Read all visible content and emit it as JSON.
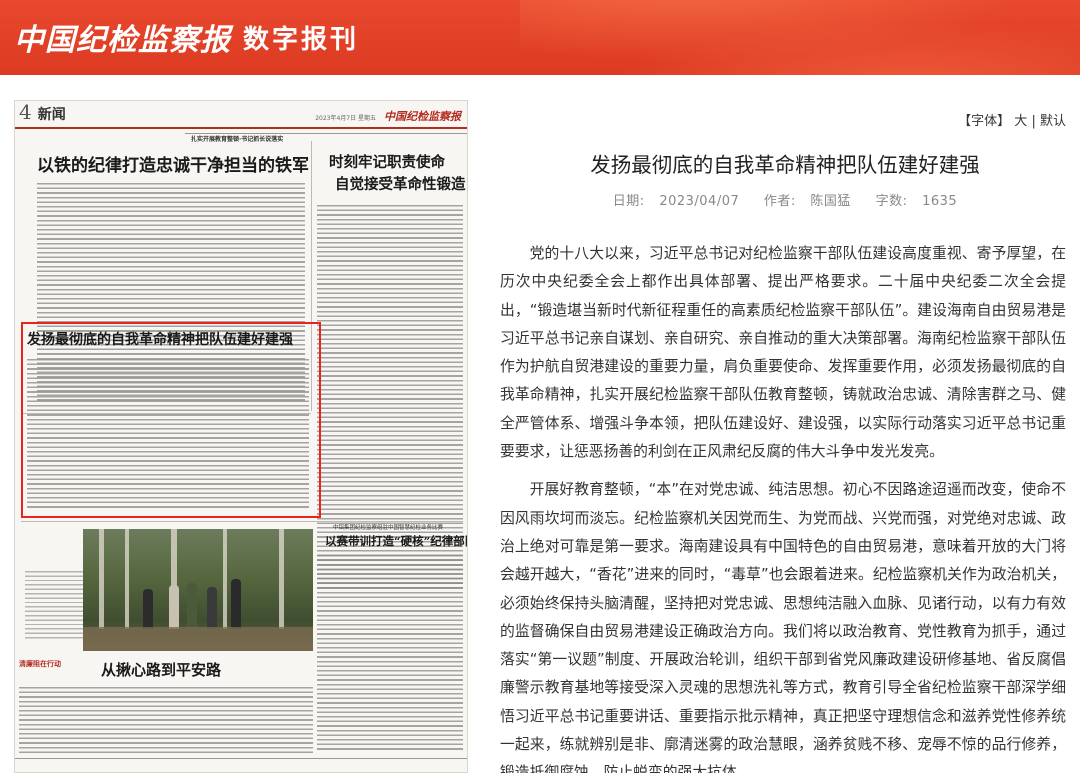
{
  "header": {
    "logo_main": "中国纪检监察报",
    "logo_sub": "数字报刊",
    "brand_color": "#dc3a22"
  },
  "paper": {
    "page_number": "4",
    "section": "新闻",
    "date": "2023年4月7日 星期五",
    "masthead": "中国纪检监察报",
    "banner": "扎实开展教育整顿·书记抓长说落实",
    "headlines": {
      "h1": "以铁的纪律打造忠诚干净担当的铁军",
      "h2a": "时刻牢记职责使命",
      "h2b": "自觉接受革命性锻造",
      "h3": "发扬最彻底的自我革命精神把队伍建好建强",
      "h4_kicker": "中铝集团纪检监察组驻中国智慧纪检业务比赛",
      "h4": "以赛带训打造“硬核”纪律部队",
      "h5": "从揪心路到平安路",
      "section_tag": "清廉阻在行动"
    },
    "highlight_color": "#e8241c"
  },
  "font_control": {
    "label": "【字体】",
    "large": "大",
    "sep": "|",
    "default": "默认"
  },
  "article": {
    "title": "发扬最彻底的自我革命精神把队伍建好建强",
    "date_label": "日期:",
    "date": "2023/04/07",
    "author_label": "作者:",
    "author": "陈国猛",
    "words_label": "字数:",
    "words": "1635",
    "paragraphs": [
      "党的十八大以来，习近平总书记对纪检监察干部队伍建设高度重视、寄予厚望，在历次中央纪委全会上都作出具体部署、提出严格要求。二十届中央纪委二次全会提出，“锻造堪当新时代新征程重任的高素质纪检监察干部队伍”。建设海南自由贸易港是习近平总书记亲自谋划、亲自研究、亲自推动的重大决策部署。海南纪检监察干部队伍作为护航自贸港建设的重要力量，肩负重要使命、发挥重要作用，必须发扬最彻底的自我革命精神，扎实开展纪检监察干部队伍教育整顿，铸就政治忠诚、清除害群之马、健全严管体系、增强斗争本领，把队伍建设好、建设强，以实际行动落实习近平总书记重要要求，让惩恶扬善的利剑在正风肃纪反腐的伟大斗争中发光发亮。",
      "开展好教育整顿，“本”在对党忠诚、纯洁思想。初心不因路途迢遥而改变，使命不因风雨坎坷而淡忘。纪检监察机关因党而生、为党而战、兴党而强，对党绝对忠诚、政治上绝对可靠是第一要求。海南建设具有中国特色的自由贸易港，意味着开放的大门将会越开越大，“香花”进来的同时，“毒草”也会跟着进来。纪检监察机关作为政治机关，必须始终保持头脑清醒，坚持把对党忠诚、思想纯洁融入血脉、见诸行动，以有力有效的监督确保自由贸易港建设正确政治方向。我们将以政治教育、党性教育为抓手，通过落实“第一议题”制度、开展政治轮训，组织干部到省党风廉政建设研修基地、省反腐倡廉警示教育基地等接受深入灵魂的思想洗礼等方式，教育引导全省纪检监察干部深学细悟习近平总书记重要讲话、重要指示批示精神，真正把坚守理想信念和滋养党性修养统一起来，练就辨别是非、廓清迷雾的政治慧眼，涵养贫贱不移、宠辱不惊的品行修养，锻造抵御腐蚀、防止蜕变的强大抗体。"
    ]
  }
}
